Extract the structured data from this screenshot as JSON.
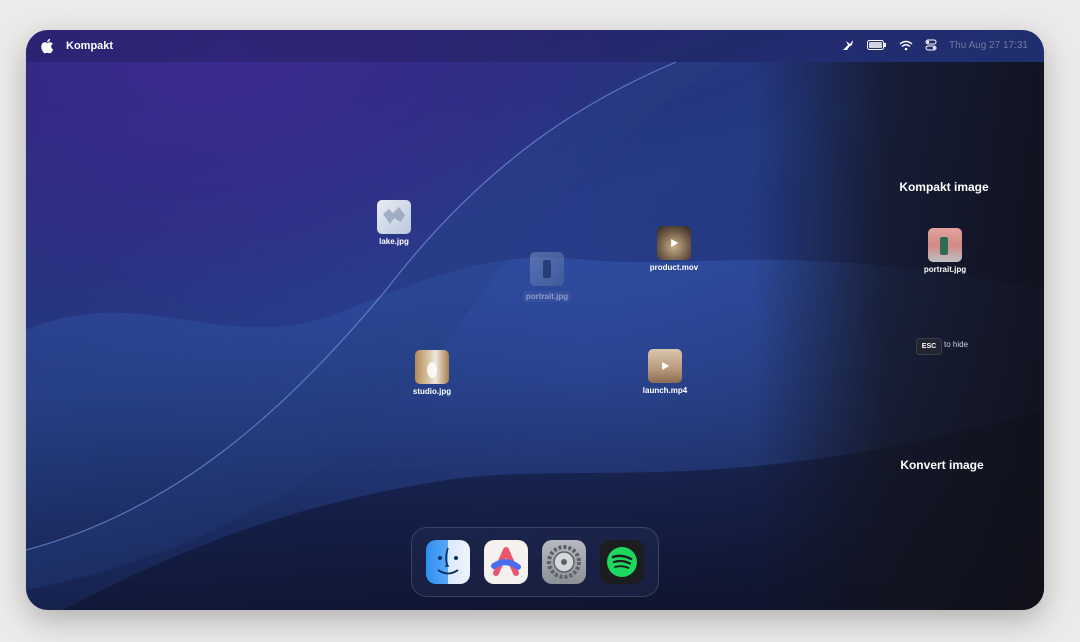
{
  "menubar": {
    "app_name": "Kompakt",
    "clock": "Thu Aug 27 17:31",
    "icons": [
      "apple-icon",
      "bird-icon",
      "battery-icon",
      "wifi-icon",
      "control-center-icon"
    ]
  },
  "desktop": {
    "files": [
      {
        "name": "lake.jpg",
        "kind": "image"
      },
      {
        "name": "portrait.jpg",
        "kind": "image"
      },
      {
        "name": "product.mov",
        "kind": "video"
      },
      {
        "name": "studio.jpg",
        "kind": "image"
      },
      {
        "name": "launch.mp4",
        "kind": "video"
      }
    ]
  },
  "panel": {
    "kompakt_title": "Kompakt image",
    "dragged_file": "portrait.jpg",
    "esc_key": "ESC",
    "esc_hint": "to hide",
    "konvert_title": "Konvert image"
  },
  "dock": {
    "apps": [
      "finder-icon",
      "arc-icon",
      "system-settings-icon",
      "spotify-icon"
    ]
  }
}
